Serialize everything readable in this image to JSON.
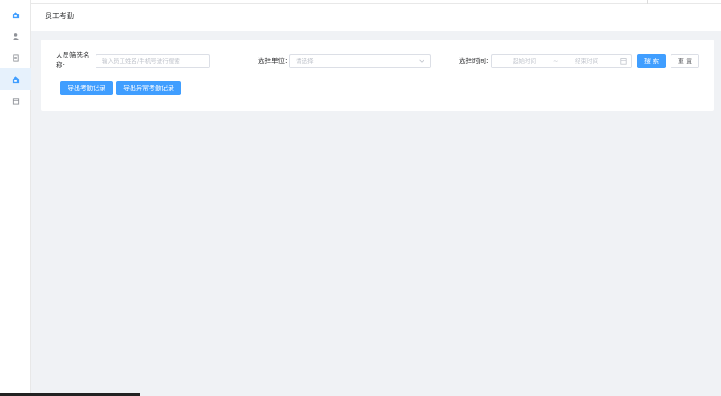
{
  "page": {
    "title": "员工考勤"
  },
  "sidebar": {
    "items": [
      {
        "icon": "home-icon",
        "active": false
      },
      {
        "icon": "user-icon",
        "active": false
      },
      {
        "icon": "document-icon",
        "active": false
      },
      {
        "icon": "attendance-icon",
        "active": true
      },
      {
        "icon": "calendar-icon",
        "active": false
      }
    ]
  },
  "filters": {
    "name_label": "人员筛选名称:",
    "name_placeholder": "输入员工姓名/手机号进行搜索",
    "unit_label": "选择单位:",
    "unit_placeholder": "请选择",
    "time_label": "选择时间:",
    "start_placeholder": "起始时间",
    "range_separator": "~",
    "end_placeholder": "结束时间"
  },
  "actions": {
    "search_label": "搜 索",
    "reset_label": "重 置",
    "export_label": "导出考勤记录",
    "export_abnormal_label": "导出异常考勤记录"
  },
  "colors": {
    "primary": "#409eff",
    "sidebar_active": "#e6f1fc",
    "background": "#f0f2f5"
  }
}
